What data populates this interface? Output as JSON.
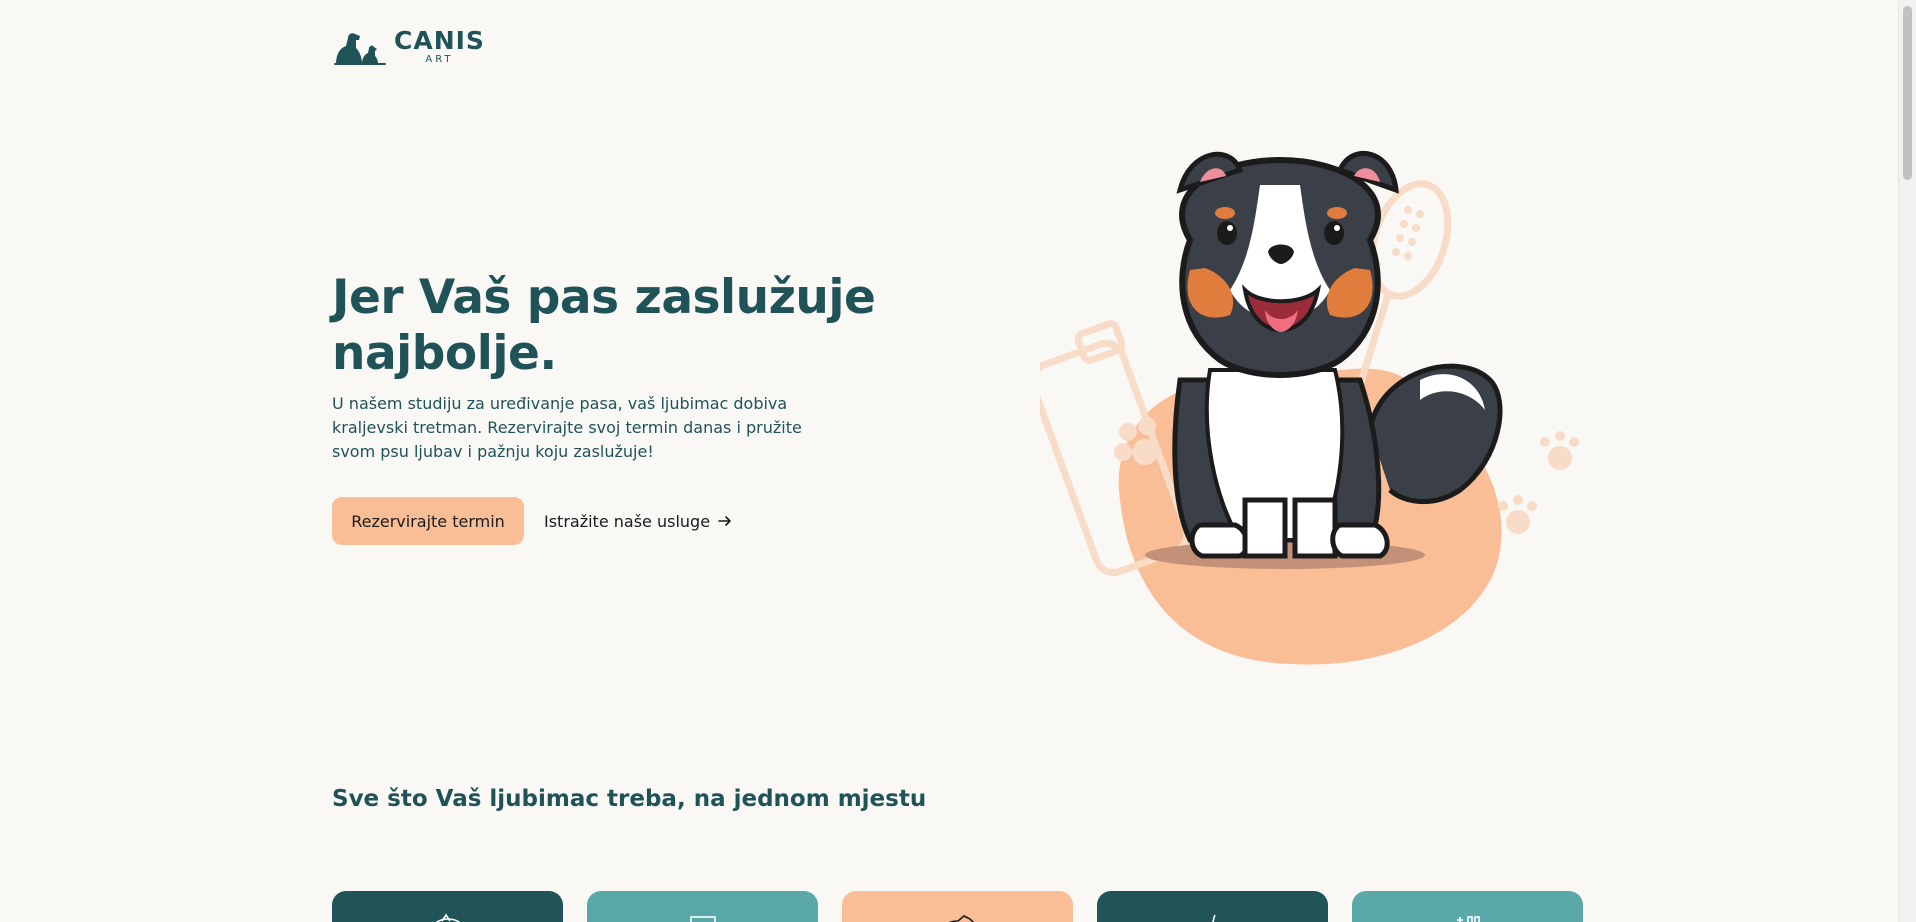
{
  "brand": {
    "name": "CANIS",
    "tagline": "ART",
    "logo_icon": "dogs-icon",
    "color_primary": "#1f5358",
    "color_accent": "#f9be96"
  },
  "hero": {
    "title": "Jer Vaš pas zaslužuje najbolje.",
    "description": "U našem studiju za uređivanje pasa, vaš ljubimac dobiva kraljevski tretman. Rezervirajte svoj termin danas i pružite svom psu ljubav i pažnju koju zaslužuje!",
    "primary_button": "Rezervirajte termin",
    "secondary_link": "Istražite naše usluge",
    "secondary_link_icon": "arrow-right-icon",
    "illustration": "dog-illustration"
  },
  "services": {
    "title": "Sve što Vaš ljubimac treba, na jednom mjestu",
    "cards": [
      {
        "icon": "dog-bath-icon",
        "color": "#215459"
      },
      {
        "icon": "brush-icon",
        "color": "#5aa8a8"
      },
      {
        "icon": "dog-icon",
        "color": "#f9be96"
      },
      {
        "icon": "scissors-icon",
        "color": "#215459"
      },
      {
        "icon": "shampoo-icon",
        "color": "#5aa8a8"
      }
    ]
  }
}
